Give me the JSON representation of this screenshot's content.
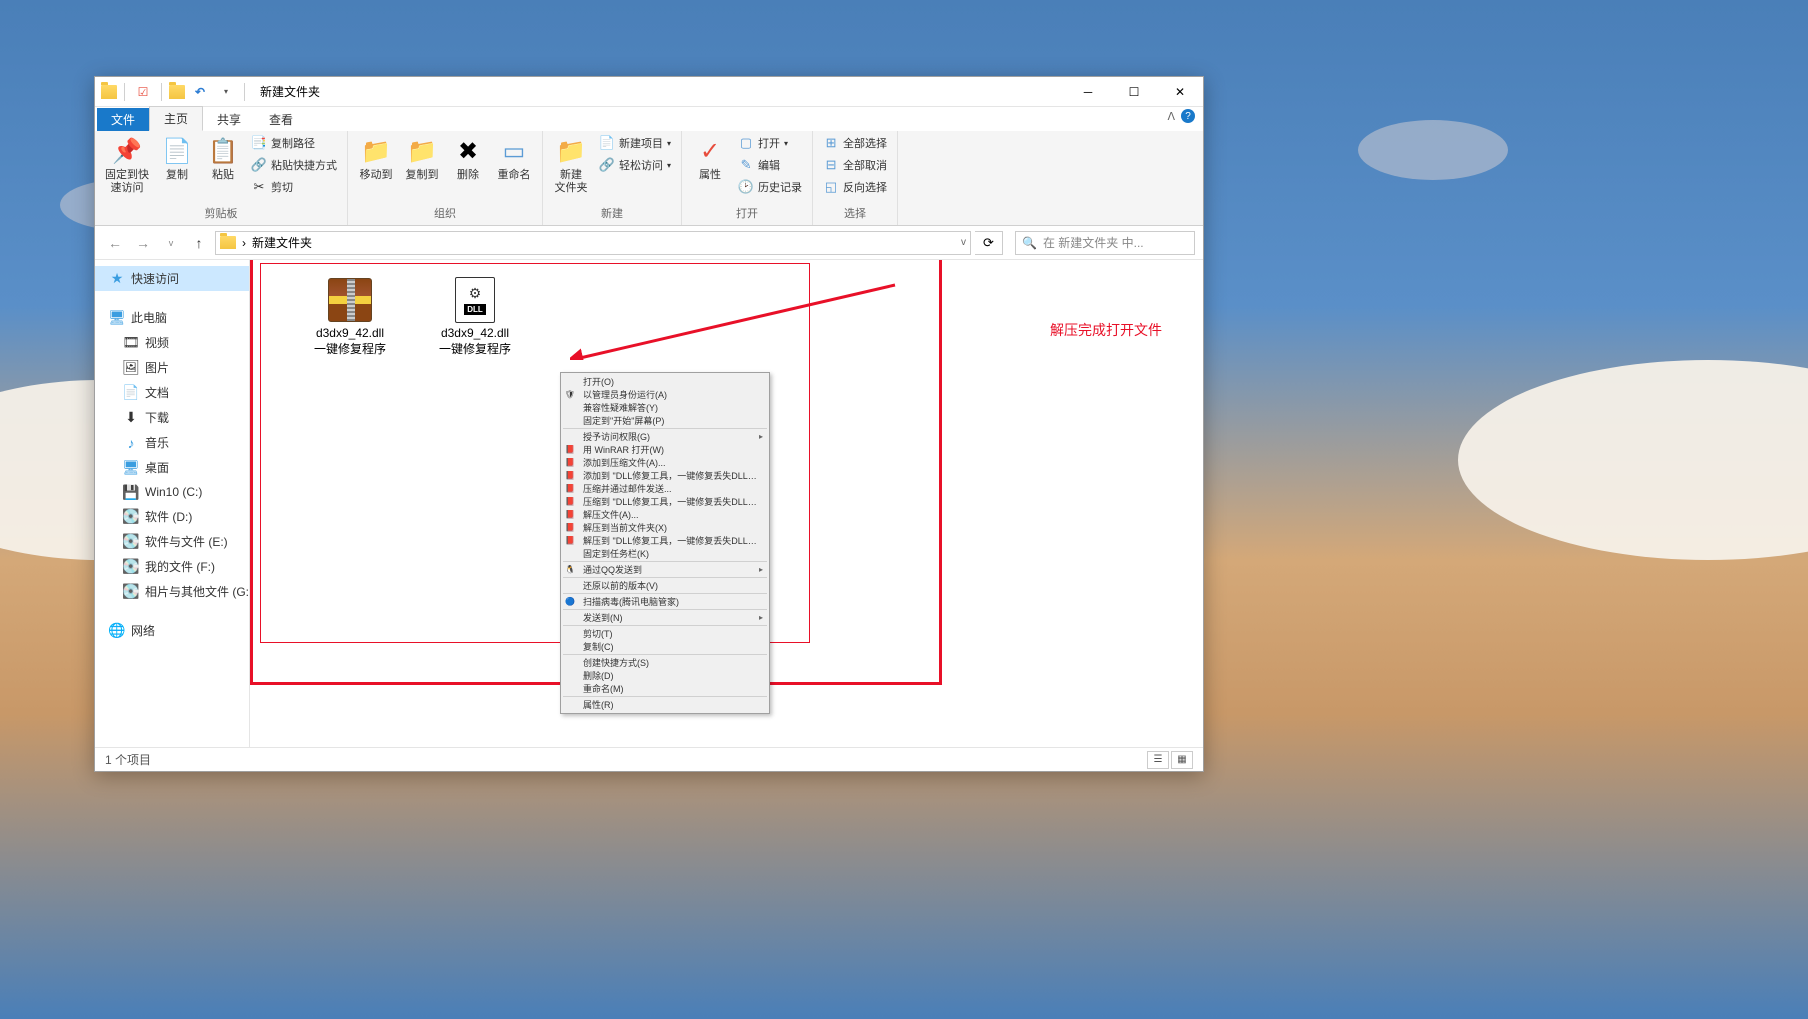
{
  "window": {
    "title": "新建文件夹"
  },
  "tabs": {
    "file": "文件",
    "home": "主页",
    "share": "共享",
    "view": "查看"
  },
  "ribbon": {
    "clipboard": {
      "label": "剪贴板",
      "pin": "固定到快\n速访问",
      "copy": "复制",
      "paste": "粘贴",
      "copy_path": "复制路径",
      "paste_shortcut": "粘贴快捷方式",
      "cut": "剪切"
    },
    "organize": {
      "label": "组织",
      "move_to": "移动到",
      "copy_to": "复制到",
      "delete": "删除",
      "rename": "重命名"
    },
    "new": {
      "label": "新建",
      "new_folder": "新建\n文件夹",
      "new_item": "新建项目",
      "easy_access": "轻松访问"
    },
    "open": {
      "label": "打开",
      "properties": "属性",
      "open": "打开",
      "edit": "编辑",
      "history": "历史记录"
    },
    "select": {
      "label": "选择",
      "select_all": "全部选择",
      "select_none": "全部取消",
      "invert": "反向选择"
    }
  },
  "address": {
    "path": "新建文件夹",
    "dropdown": "v"
  },
  "search": {
    "placeholder": "在 新建文件夹 中..."
  },
  "sidebar": {
    "quick_access": "快速访问",
    "this_pc": "此电脑",
    "videos": "视频",
    "pictures": "图片",
    "documents": "文档",
    "downloads": "下载",
    "music": "音乐",
    "desktop": "桌面",
    "drive_c": "Win10 (C:)",
    "drive_d": "软件 (D:)",
    "drive_e": "软件与文件 (E:)",
    "drive_f": "我的文件 (F:)",
    "drive_g": "相片与其他文件 (G:)",
    "network": "网络"
  },
  "files": [
    {
      "name": "d3dx9_42.dll\n一键修复程序"
    },
    {
      "name": "d3dx9_42.dll\n一键修复程序"
    }
  ],
  "context_menu": [
    {
      "label": "打开(O)",
      "type": "item"
    },
    {
      "label": "以管理员身份运行(A)",
      "type": "item",
      "icon": "🛡"
    },
    {
      "label": "兼容性疑难解答(Y)",
      "type": "item"
    },
    {
      "label": "固定到\"开始\"屏幕(P)",
      "type": "item"
    },
    {
      "type": "sep"
    },
    {
      "label": "授予访问权限(G)",
      "type": "item",
      "arrow": true
    },
    {
      "label": "用 WinRAR 打开(W)",
      "type": "item",
      "icon": "📕"
    },
    {
      "label": "添加到压缩文件(A)...",
      "type": "item",
      "icon": "📕"
    },
    {
      "label": "添加到 \"DLL修复工具，一键修复丢失DLL文件.rar\"(T)",
      "type": "item",
      "icon": "📕"
    },
    {
      "label": "压缩并通过邮件发送...",
      "type": "item",
      "icon": "📕"
    },
    {
      "label": "压缩到 \"DLL修复工具，一键修复丢失DLL文件.rar\" 并通过邮件发送",
      "type": "item",
      "icon": "📕"
    },
    {
      "label": "解压文件(A)...",
      "type": "item",
      "icon": "📕"
    },
    {
      "label": "解压到当前文件夹(X)",
      "type": "item",
      "icon": "📕"
    },
    {
      "label": "解压到 \"DLL修复工具，一键修复丢失DLL文件\\\"(E)",
      "type": "item",
      "icon": "📕"
    },
    {
      "label": "固定到任务栏(K)",
      "type": "item"
    },
    {
      "type": "sep"
    },
    {
      "label": "通过QQ发送到",
      "type": "item",
      "icon": "🐧",
      "arrow": true
    },
    {
      "type": "sep"
    },
    {
      "label": "还原以前的版本(V)",
      "type": "item"
    },
    {
      "type": "sep"
    },
    {
      "label": "扫描病毒(腾讯电脑管家)",
      "type": "item",
      "icon": "🔵"
    },
    {
      "type": "sep"
    },
    {
      "label": "发送到(N)",
      "type": "item",
      "arrow": true
    },
    {
      "type": "sep"
    },
    {
      "label": "剪切(T)",
      "type": "item"
    },
    {
      "label": "复制(C)",
      "type": "item"
    },
    {
      "type": "sep"
    },
    {
      "label": "创建快捷方式(S)",
      "type": "item"
    },
    {
      "label": "删除(D)",
      "type": "item"
    },
    {
      "label": "重命名(M)",
      "type": "item"
    },
    {
      "type": "sep"
    },
    {
      "label": "属性(R)",
      "type": "item"
    }
  ],
  "annotation": "解压完成打开文件",
  "statusbar": {
    "item_count": "1 个项目"
  }
}
